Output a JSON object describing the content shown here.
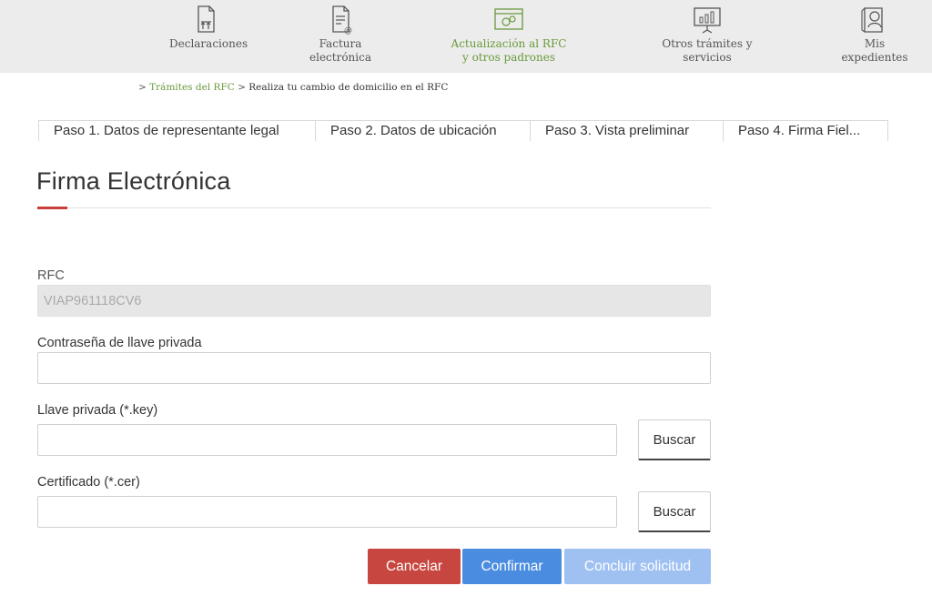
{
  "nav": {
    "items": [
      {
        "label": "Declaraciones",
        "icon": "declaraciones-icon"
      },
      {
        "label": "Factura electrónica",
        "icon": "factura-icon"
      },
      {
        "label": "Actualización al RFC y otros padrones",
        "icon": "rfc-update-icon"
      },
      {
        "label": "Otros trámites y servicios",
        "icon": "chart-presentation-icon"
      },
      {
        "label": "Mis expedientes",
        "icon": "expediente-icon"
      }
    ],
    "active_color": "#6a9a3c"
  },
  "breadcrumb": {
    "sep1": ">",
    "link": "Trámites del RFC",
    "sep2": ">",
    "current": "Realiza tu cambio de domicilio en el RFC"
  },
  "steps": [
    "Paso 1. Datos de representante legal",
    "Paso 2. Datos de ubicación",
    "Paso 3. Vista preliminar",
    "Paso 4. Firma Fiel..."
  ],
  "page": {
    "title": "Firma Electrónica",
    "accent_color": "#c73f3a"
  },
  "form": {
    "rfc_label": "RFC",
    "rfc_value": "VIAP961118CV6",
    "password_label": "Contraseña de llave privada",
    "key_label": "Llave privada (*.key)",
    "cert_label": "Certificado (*.cer)",
    "browse_label": "Buscar"
  },
  "actions": {
    "cancel": "Cancelar",
    "confirm": "Confirmar",
    "conclude": "Concluir solicitud"
  }
}
